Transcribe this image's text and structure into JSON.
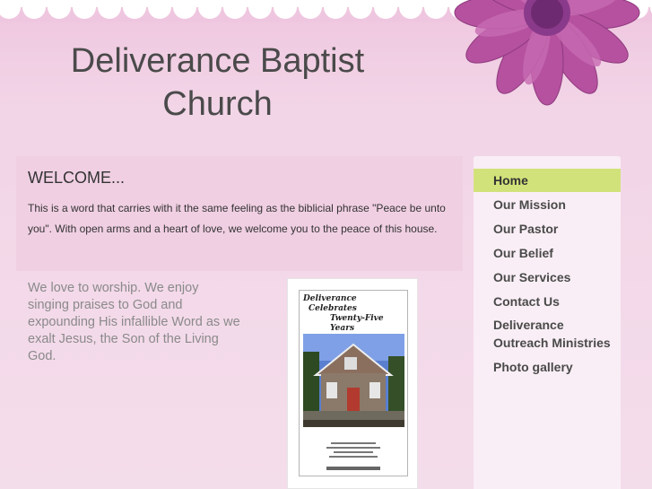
{
  "site": {
    "title_line1": "Deliverance Baptist",
    "title_line2": "Church"
  },
  "welcome": {
    "heading": "WELCOME...",
    "body": "This is a word that carries with it the same feeling as the biblicial phrase \"Peace be unto you\".  With open arms and a heart of love, we welcome you to the peace of this house."
  },
  "worship": {
    "text": "We love to worship.  We enjoy singing praises to God and expounding His infallible Word as we exalt Jesus, the Son of the Living God."
  },
  "flyer": {
    "line1": "Deliverance",
    "line2": "Celebrates",
    "line3": "Twenty-Five Years"
  },
  "nav": {
    "active": "Home",
    "items": [
      {
        "label": "Home"
      },
      {
        "label": "Our Mission"
      },
      {
        "label": "Our Pastor"
      },
      {
        "label": "Our Belief"
      },
      {
        "label": "Our Services"
      },
      {
        "label": "Contact Us"
      },
      {
        "label": "Deliverance Outreach Ministries"
      },
      {
        "label": "Photo gallery"
      }
    ]
  },
  "colors": {
    "nav_active_bg": "#d2e27a",
    "welcome_bg": "#f0cfe3",
    "flower": "#b5519f"
  },
  "icons": {
    "header_decoration": "flower-icon"
  }
}
